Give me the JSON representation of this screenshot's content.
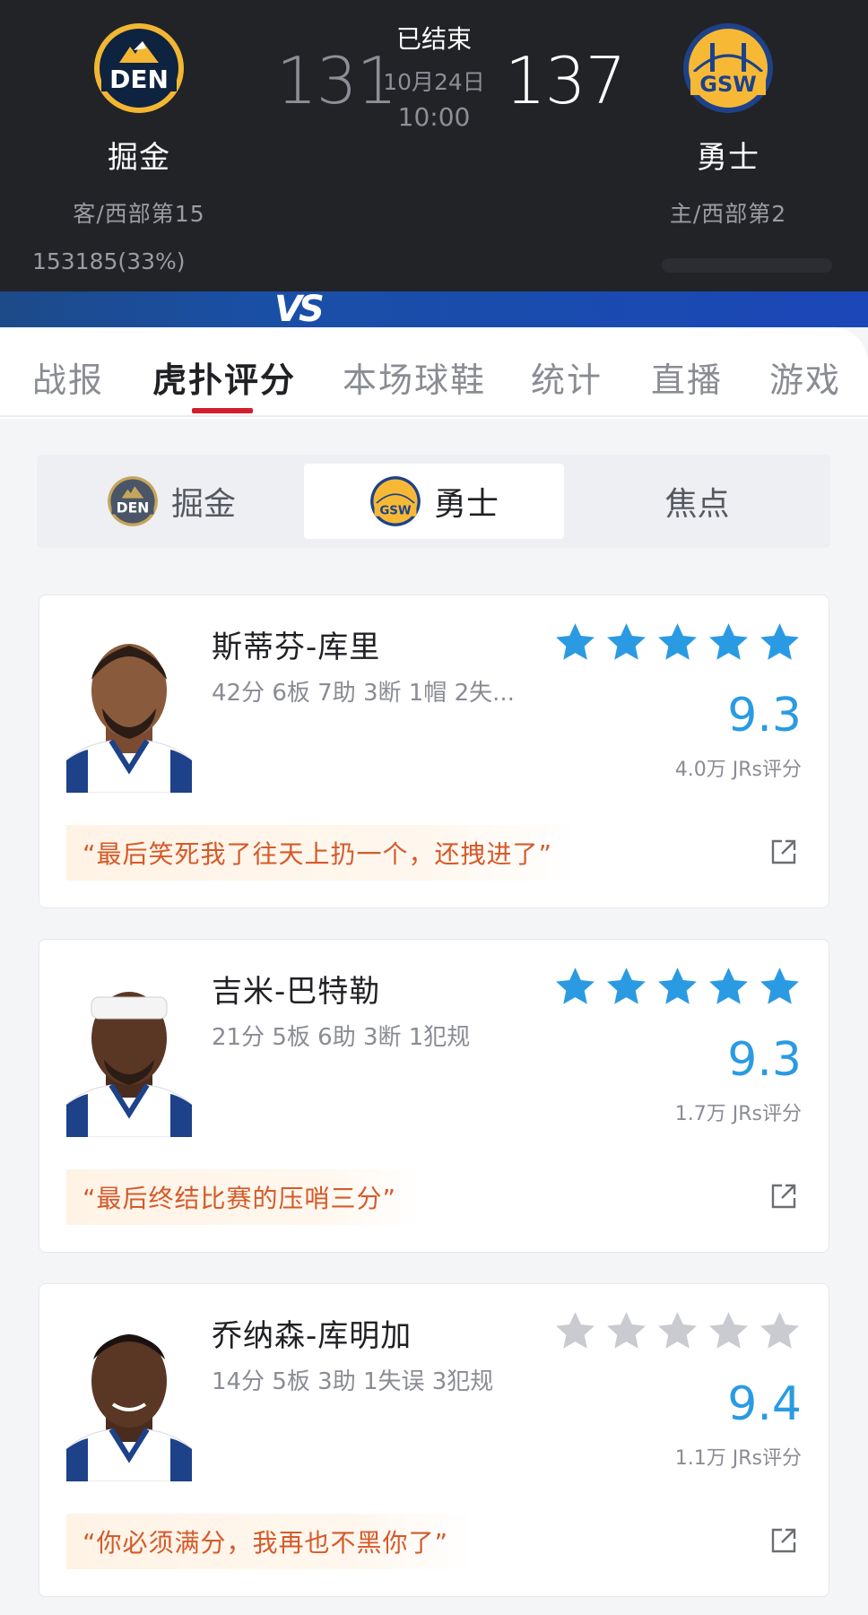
{
  "header": {
    "away": {
      "name": "掘金",
      "rank": "客/西部第15",
      "abbr": "DEN",
      "score": "131"
    },
    "home": {
      "name": "勇士",
      "rank": "主/西部第2",
      "abbr": "GSW",
      "score": "137"
    },
    "status": "已结束",
    "date": "10月24日",
    "time": "10:00",
    "support_left": "153185(33%)",
    "vs": "VS"
  },
  "tabs": [
    {
      "label": "战报"
    },
    {
      "label": "虎扑评分"
    },
    {
      "label": "本场球鞋"
    },
    {
      "label": "统计"
    },
    {
      "label": "直播"
    },
    {
      "label": "游戏"
    }
  ],
  "segment": {
    "items": [
      {
        "label": "掘金",
        "abbr": "DEN"
      },
      {
        "label": "勇士",
        "abbr": "GSW"
      },
      {
        "label": "焦点"
      }
    ],
    "selected": "勇士"
  },
  "players": [
    {
      "name": "斯蒂芬-库里",
      "stats": "42分 6板 7助 3断 1帽 2失...",
      "stars_filled": 5,
      "rating": "9.3",
      "votes": "4.0万 JRs评分",
      "quote": "“最后笑死我了往天上扔一个，还拽进了”"
    },
    {
      "name": "吉米-巴特勒",
      "stats": "21分 5板 6助 3断 1犯规",
      "stars_filled": 5,
      "rating": "9.3",
      "votes": "1.7万 JRs评分",
      "quote": "“最后终结比赛的压哨三分”"
    },
    {
      "name": "乔纳森-库明加",
      "stats": "14分 5板 3助 1失误 3犯规",
      "stars_filled": 0,
      "rating": "9.4",
      "votes": "1.1万 JRs评分",
      "quote": "“你必须满分，我再也不黑你了”"
    }
  ],
  "colors": {
    "header_bg": "#222327",
    "accent_red": "#d0202e",
    "rating_blue": "#2a9be3",
    "star_filled": "#2a9be3",
    "star_empty": "#c9cbd1",
    "quote_orange": "#d55a2a"
  },
  "icons": [
    "den-logo-icon",
    "gsw-logo-icon",
    "star-icon",
    "share-icon"
  ]
}
